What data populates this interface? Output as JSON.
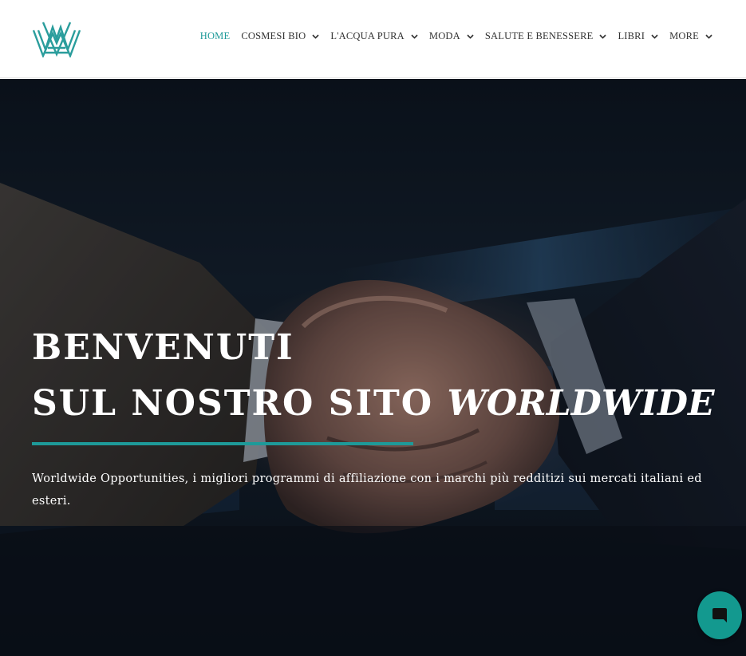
{
  "header": {
    "logo_icon": "crown-w-logo-icon",
    "nav": [
      {
        "label": "HOME",
        "active": true,
        "has_dropdown": false
      },
      {
        "label": "COSMESI BIO",
        "active": false,
        "has_dropdown": true
      },
      {
        "label": "L'ACQUA PURA",
        "active": false,
        "has_dropdown": true
      },
      {
        "label": "MODA",
        "active": false,
        "has_dropdown": true
      },
      {
        "label": "SALUTE E BENESSERE",
        "active": false,
        "has_dropdown": true
      },
      {
        "label": "LIBRI",
        "active": false,
        "has_dropdown": true
      },
      {
        "label": "MORE",
        "active": false,
        "has_dropdown": true
      }
    ]
  },
  "hero": {
    "background_image": "handshake-photo",
    "headline_line1": "BENVENUTI",
    "headline_line2": "SUL NOSTRO SITO",
    "headline_accent": "WORLDWIDE",
    "subtitle": "Worldwide Opportunities, i migliori programmi di affiliazione con i marchi più redditizi sui mercati italiani ed esteri."
  },
  "chat": {
    "icon": "chat-bubble-icon"
  },
  "colors": {
    "accent": "#1e9a99",
    "chat": "#13998f",
    "nav_text": "#333333"
  }
}
